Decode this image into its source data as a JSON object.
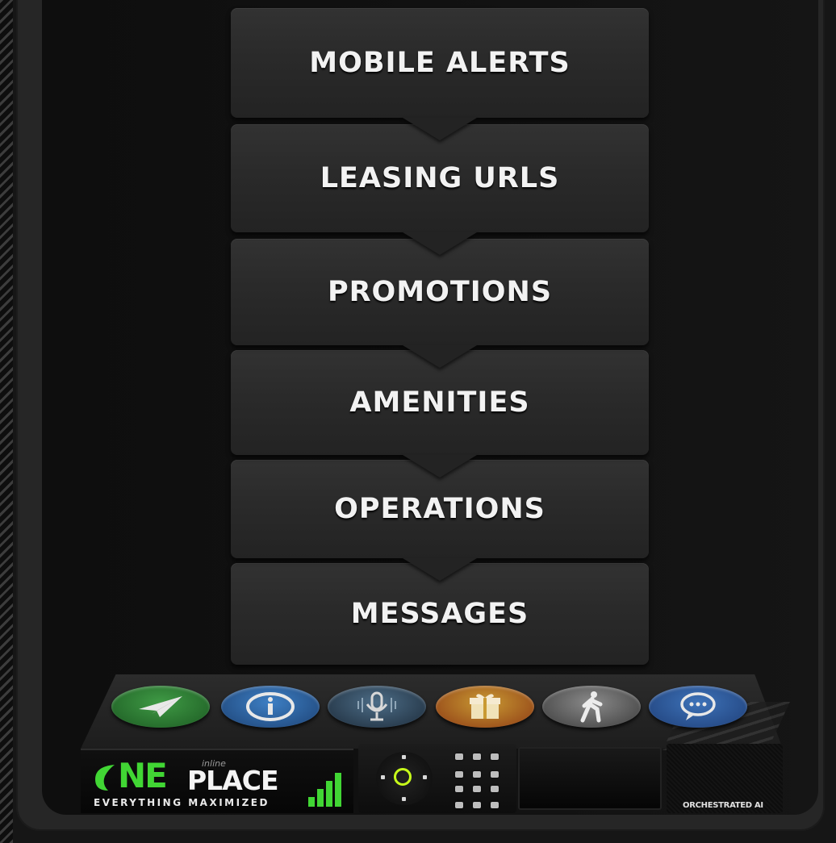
{
  "menu": {
    "items": [
      {
        "label": "MOBILE ALERTS"
      },
      {
        "label": "LEASING URLS"
      },
      {
        "label": "PROMOTIONS"
      },
      {
        "label": "AMENITIES"
      },
      {
        "label": "OPERATIONS"
      },
      {
        "label": "MESSAGES"
      }
    ]
  },
  "toolbar": {
    "buttons": [
      {
        "icon": "paper-plane-icon",
        "color": "#3f9a45"
      },
      {
        "icon": "info-icon",
        "color": "#3d7fc4"
      },
      {
        "icon": "microphone-icon",
        "color": "#4c6c86"
      },
      {
        "icon": "gift-icon",
        "color": "#c99a33"
      },
      {
        "icon": "walking-person-icon",
        "color": "#8a8a8a"
      },
      {
        "icon": "chat-bubble-icon",
        "color": "#3d72b8"
      }
    ]
  },
  "logo": {
    "ne": "NE",
    "inline": "inline",
    "place": "PLACE",
    "tagline": "EVERYTHING MAXIMIZED",
    "accent_color": "#41d634"
  },
  "badge": {
    "text": "ORCHESTRATED AI"
  }
}
